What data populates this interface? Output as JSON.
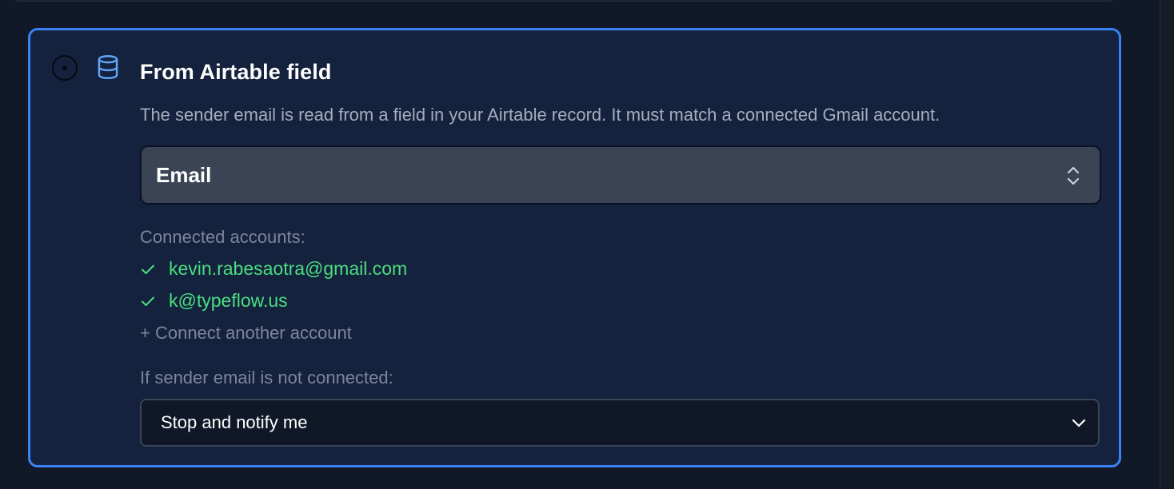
{
  "option": {
    "title": "From Airtable field",
    "description": "The sender email is read from a field in your Airtable record. It must match a connected Gmail account.",
    "icon": "database-icon",
    "selected": true
  },
  "field_select": {
    "value": "Email",
    "icon": "chevron-up-down-icon"
  },
  "connected": {
    "label": "Connected accounts:",
    "accounts": [
      {
        "email": "kevin.rabesaotra@gmail.com",
        "icon": "check-icon"
      },
      {
        "email": "k@typeflow.us",
        "icon": "check-icon"
      }
    ],
    "connect_link": "+ Connect another account"
  },
  "fallback": {
    "label": "If sender email is not connected:",
    "value": "Stop and notify me",
    "icon": "chevron-down-icon"
  },
  "colors": {
    "accent": "#3b82f6",
    "success": "#4ade80",
    "card_bg": "#15223d",
    "page_bg": "#111827"
  }
}
